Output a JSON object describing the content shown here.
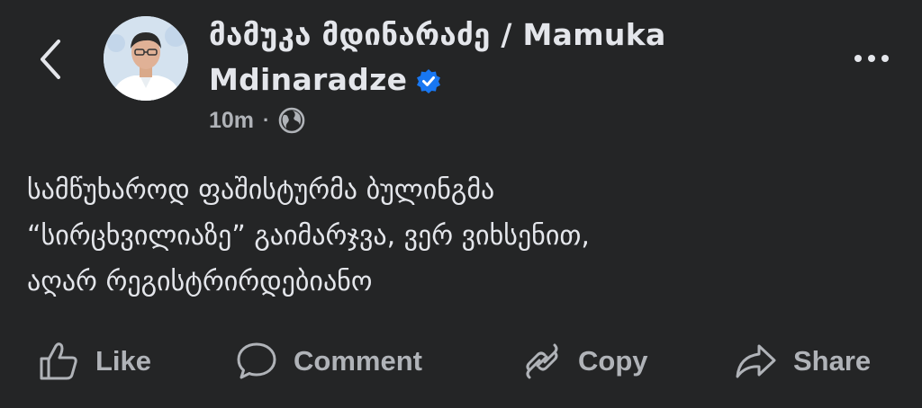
{
  "header": {
    "author_name": "მამუკა მდინარაძე / Mamuka Mdinaradze",
    "verified_icon": "verified-badge-icon",
    "timestamp": "10m",
    "separator": "·",
    "audience_icon": "globe-icon"
  },
  "post": {
    "text": "სამწუხაროდ ფაშისტურმა ბულინგმა\n“სირცხვილიაზე” გაიმარჯვა, ვერ ვიხსენით,\nაღარ რეგისტრირდებიანო"
  },
  "actions": {
    "like_label": "Like",
    "comment_label": "Comment",
    "copy_label": "Copy",
    "share_label": "Share"
  },
  "colors": {
    "background": "#242526",
    "primary_text": "#e4e6eb",
    "secondary_text": "#b0b3b8",
    "verified_blue": "#1877f2"
  }
}
